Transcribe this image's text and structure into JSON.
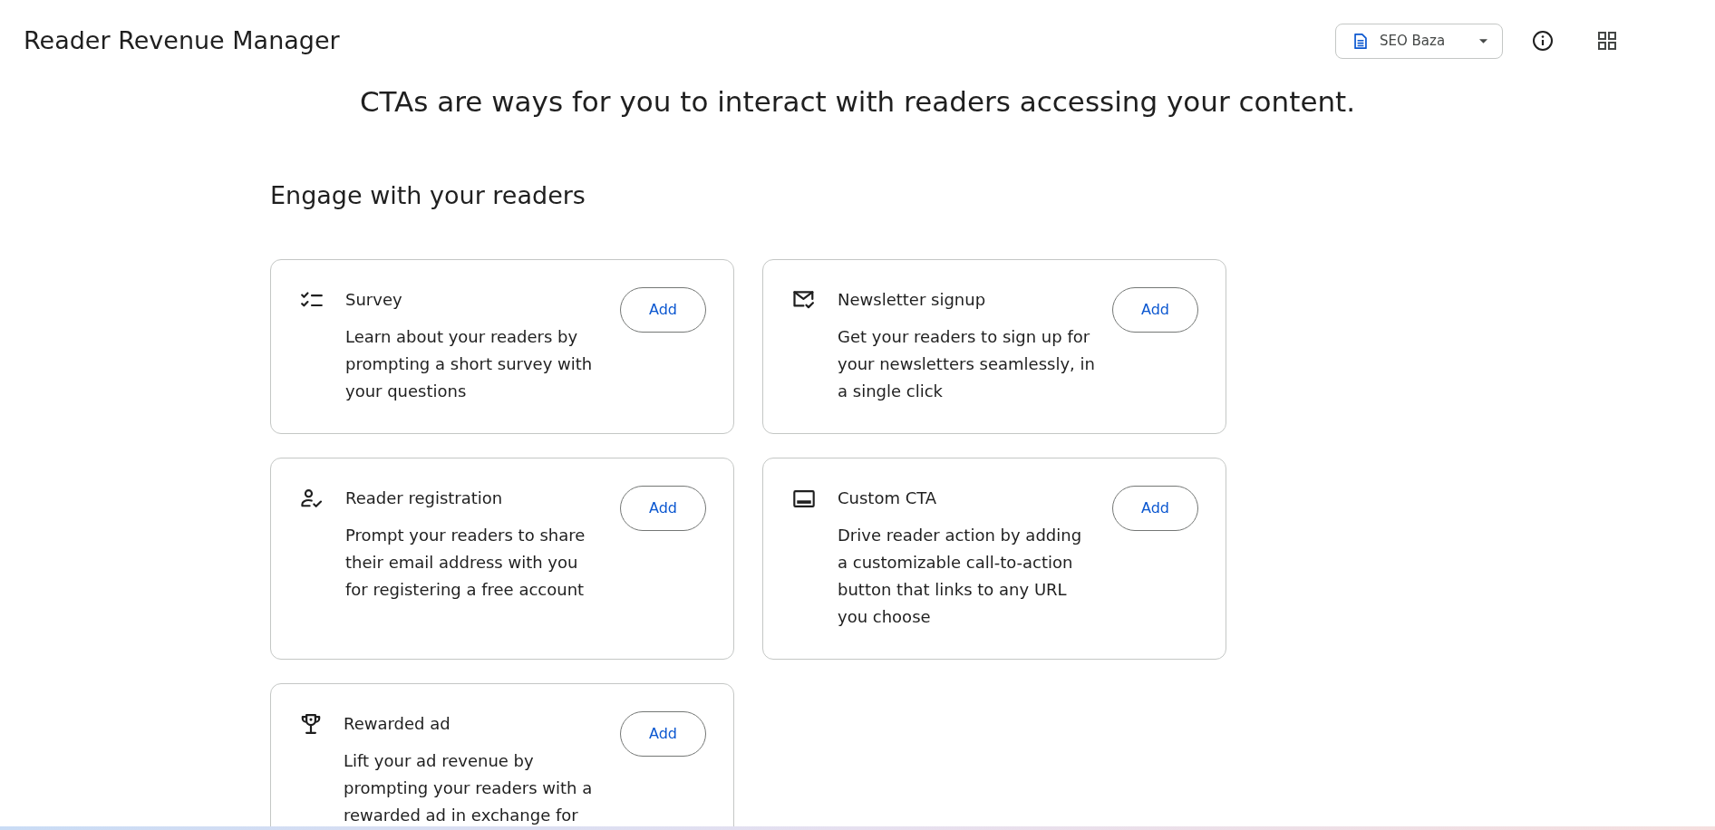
{
  "header": {
    "title": "Reader Revenue Manager",
    "publication_selector": {
      "label": "SEO Baza"
    }
  },
  "intro": "CTAs are ways for you to interact with readers accessing your content.",
  "section": {
    "title": "Engage with your readers",
    "cards": [
      {
        "kind": "survey",
        "title": "Survey",
        "description": [
          "Learn about your readers by",
          "prompting a short survey with",
          "your questions"
        ],
        "button": "Add"
      },
      {
        "kind": "newsletter",
        "title": "Newsletter signup",
        "description": [
          "Get your readers to sign up for",
          "your newsletters seamlessly, in",
          "a single click"
        ],
        "button": "Add"
      },
      {
        "kind": "registration",
        "title": "Reader registration",
        "description": [
          "Prompt your readers to share",
          "their email address with you",
          "for registering a free account"
        ],
        "button": "Add"
      },
      {
        "kind": "custom",
        "title": "Custom CTA",
        "description": [
          "Drive reader action by adding",
          "a customizable call-to-action",
          "button that links to any URL",
          "you choose"
        ],
        "button": "Add"
      },
      {
        "kind": "rewarded",
        "title": "Rewarded ad",
        "description": [
          "Lift your ad revenue by",
          "prompting your readers with a",
          "rewarded ad in exchange for"
        ],
        "button": "Add"
      }
    ]
  }
}
